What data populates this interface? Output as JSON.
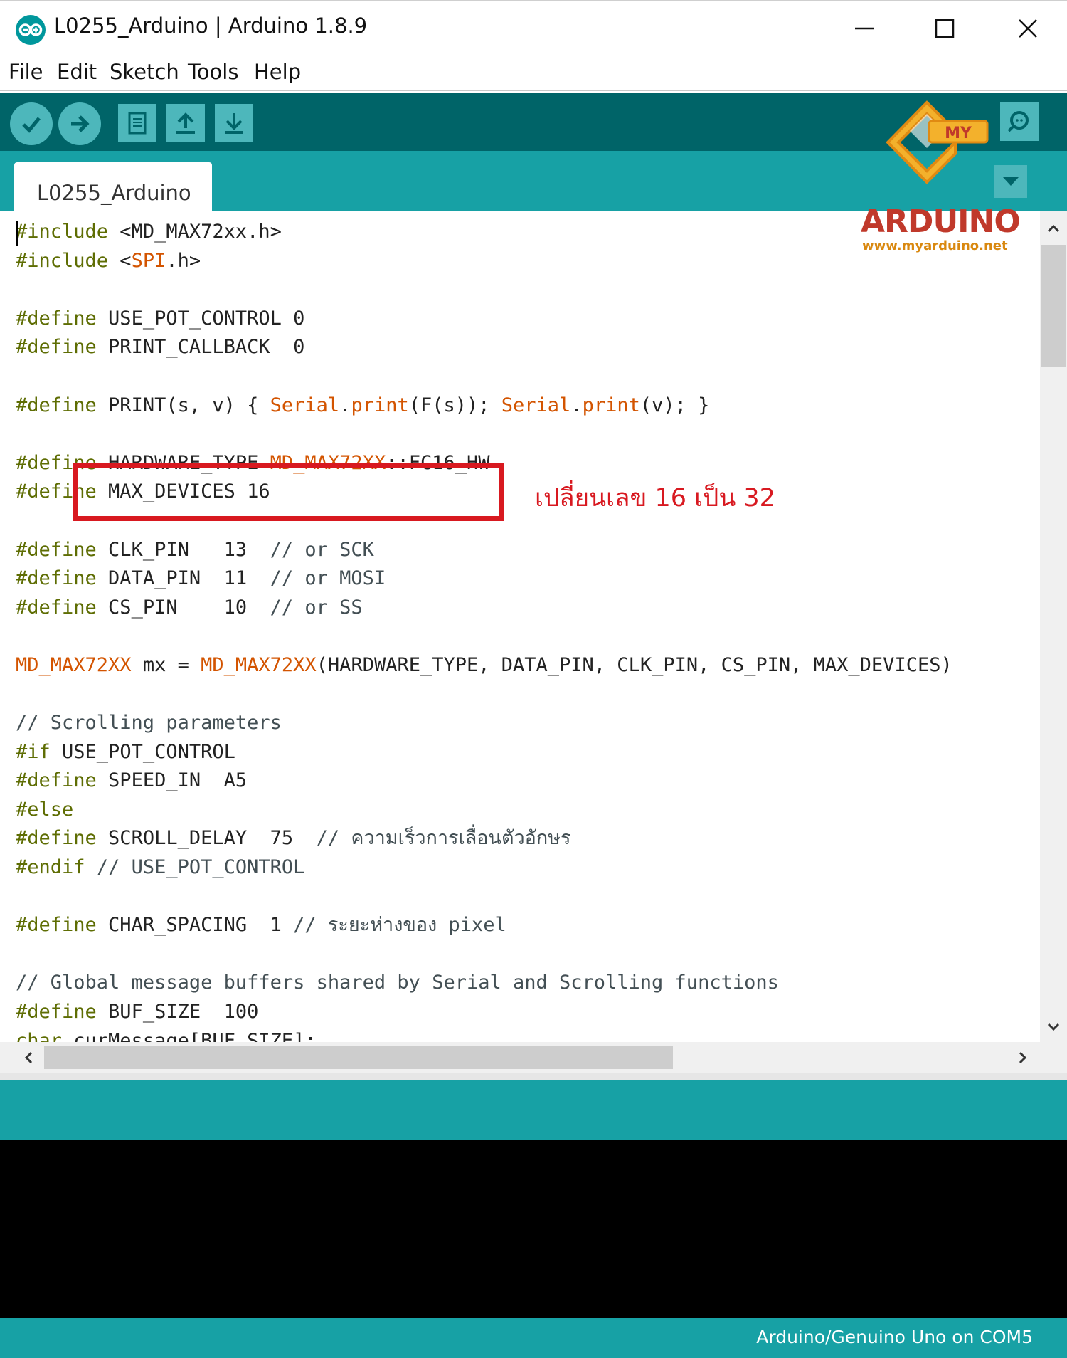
{
  "window": {
    "title": "L0255_Arduino | Arduino 1.8.9",
    "controls": [
      "minimize",
      "maximize",
      "close"
    ]
  },
  "menu": {
    "items": [
      "File",
      "Edit",
      "Sketch",
      "Tools",
      "Help"
    ]
  },
  "toolbar": {
    "buttons": [
      "verify",
      "upload",
      "new",
      "open",
      "save",
      "serial-monitor"
    ]
  },
  "tabs": {
    "active": "L0255_Arduino"
  },
  "logo": {
    "badge": "MY",
    "word": "ARDUINO",
    "url": "www.myarduino.net"
  },
  "annotation": {
    "text": "เปลี่ยนเลข 16 เป็น 32"
  },
  "code": {
    "lines": [
      [
        {
          "t": "#include",
          "c": "kw"
        },
        {
          "t": " <MD_MAX72xx.h>"
        }
      ],
      [
        {
          "t": "#include",
          "c": "kw"
        },
        {
          "t": " <"
        },
        {
          "t": "SPI",
          "c": "fn"
        },
        {
          "t": ".h>"
        }
      ],
      [],
      [
        {
          "t": "#define",
          "c": "kw"
        },
        {
          "t": " USE_POT_CONTROL 0"
        }
      ],
      [
        {
          "t": "#define",
          "c": "kw"
        },
        {
          "t": " PRINT_CALLBACK  0"
        }
      ],
      [],
      [
        {
          "t": "#define",
          "c": "kw"
        },
        {
          "t": " PRINT(s, v) { "
        },
        {
          "t": "Serial",
          "c": "fn"
        },
        {
          "t": "."
        },
        {
          "t": "print",
          "c": "fn"
        },
        {
          "t": "(F(s)); "
        },
        {
          "t": "Serial",
          "c": "fn"
        },
        {
          "t": "."
        },
        {
          "t": "print",
          "c": "fn"
        },
        {
          "t": "(v); }"
        }
      ],
      [],
      [
        {
          "t": "#define",
          "c": "kw"
        },
        {
          "t": " HARDWARE_TYPE "
        },
        {
          "t": "MD_MAX72XX",
          "c": "fn"
        },
        {
          "t": "::FC16_HW"
        }
      ],
      [
        {
          "t": "#define",
          "c": "kw"
        },
        {
          "t": " MAX_DEVICES 16"
        }
      ],
      [],
      [
        {
          "t": "#define",
          "c": "kw"
        },
        {
          "t": " CLK_PIN   13  "
        },
        {
          "t": "// or SCK",
          "c": "cm"
        }
      ],
      [
        {
          "t": "#define",
          "c": "kw"
        },
        {
          "t": " DATA_PIN  11  "
        },
        {
          "t": "// or MOSI",
          "c": "cm"
        }
      ],
      [
        {
          "t": "#define",
          "c": "kw"
        },
        {
          "t": " CS_PIN    10  "
        },
        {
          "t": "// or SS",
          "c": "cm"
        }
      ],
      [],
      [
        {
          "t": "MD_MAX72XX",
          "c": "fn"
        },
        {
          "t": " mx = "
        },
        {
          "t": "MD_MAX72XX",
          "c": "fn"
        },
        {
          "t": "(HARDWARE_TYPE, DATA_PIN, CLK_PIN, CS_PIN, MAX_DEVICES)"
        }
      ],
      [],
      [
        {
          "t": "// Scrolling parameters",
          "c": "cm"
        }
      ],
      [
        {
          "t": "#if",
          "c": "kw"
        },
        {
          "t": " USE_POT_CONTROL"
        }
      ],
      [
        {
          "t": "#define",
          "c": "kw"
        },
        {
          "t": " SPEED_IN  A5"
        }
      ],
      [
        {
          "t": "#else",
          "c": "kw"
        }
      ],
      [
        {
          "t": "#define",
          "c": "kw"
        },
        {
          "t": " SCROLL_DELAY  75  "
        },
        {
          "t": "// ความเร็วการเลื่อนตัวอักษร",
          "c": "cm"
        }
      ],
      [
        {
          "t": "#endif",
          "c": "kw"
        },
        {
          "t": " "
        },
        {
          "t": "// USE_POT_CONTROL",
          "c": "cm"
        }
      ],
      [],
      [
        {
          "t": "#define",
          "c": "kw"
        },
        {
          "t": " CHAR_SPACING  1 "
        },
        {
          "t": "// ระยะห่างของ pixel",
          "c": "cm"
        }
      ],
      [],
      [
        {
          "t": "// Global message buffers shared by Serial and Scrolling functions",
          "c": "cm"
        }
      ],
      [
        {
          "t": "#define",
          "c": "kw"
        },
        {
          "t": " BUF_SIZE  100"
        }
      ],
      [
        {
          "t": "char",
          "c": "kw"
        },
        {
          "t": " curMessage[BUF_SIZE];"
        }
      ]
    ]
  },
  "status": {
    "board": "Arduino/Genuino Uno on COM5"
  },
  "colors": {
    "toolbar": "#006468",
    "tabbar": "#17a1a5",
    "button": "#4db7bb",
    "keyword": "#5e6d03",
    "function": "#d35400",
    "annotation": "#d81920"
  }
}
